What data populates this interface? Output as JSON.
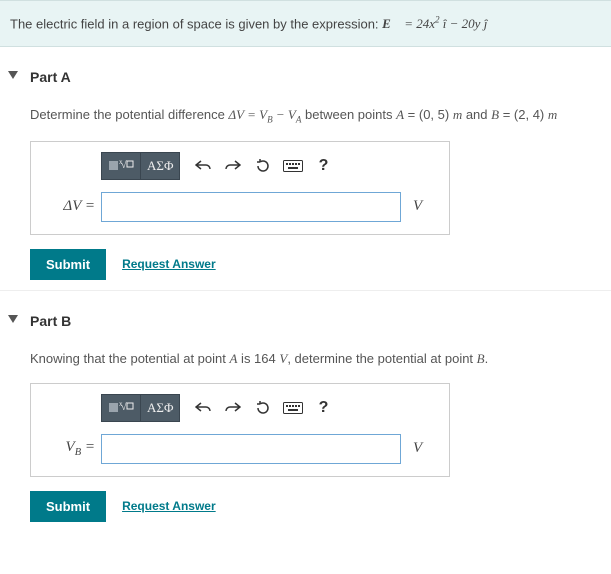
{
  "problem": {
    "leadText": "The electric field in a region of space is given by the expression: ",
    "expression_html": "<span class=\"math\"><b>E&#8407;</b> = 24x<sup>2</sup>&nbsp;i&#770; &minus; 20y&nbsp;j&#770;</span>"
  },
  "parts": [
    {
      "title": "Part A",
      "prompt_html": "Determine the potential difference <span class=\"math\">&Delta;V = V<sub>B</sub> &minus; V<sub>A</sub></span> between points <span class=\"math\">A</span> = (0, 5) <span class=\"math\">m</span> and <span class=\"math\">B</span> = (2, 4) <span class=\"math\">m</span>",
      "answer_label_html": "&Delta;V =",
      "unit": "V",
      "value": "",
      "toolbar": {
        "greek": "ΑΣΦ",
        "help": "?"
      },
      "submit": "Submit",
      "request": "Request Answer"
    },
    {
      "title": "Part B",
      "prompt_html": "Knowing that the potential at point <span class=\"math\">A</span> is 164 <span class=\"math\">V</span>, determine the potential at point <span class=\"math\">B</span>.",
      "answer_label_html": "V<sub>B</sub> =",
      "unit": "V",
      "value": "",
      "toolbar": {
        "greek": "ΑΣΦ",
        "help": "?"
      },
      "submit": "Submit",
      "request": "Request Answer"
    }
  ]
}
